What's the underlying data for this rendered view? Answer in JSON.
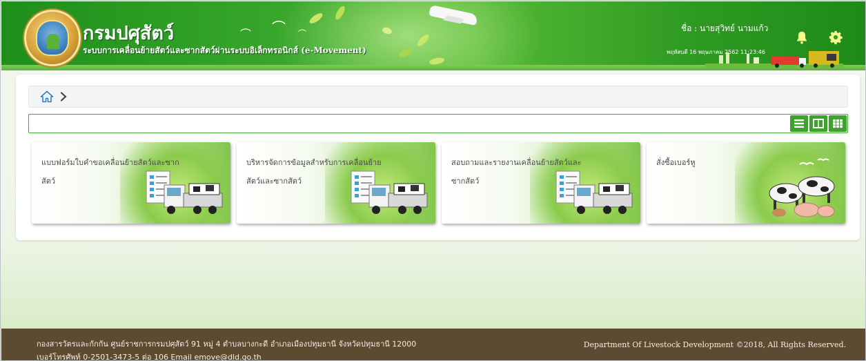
{
  "header": {
    "title": "กรมปศุสัตว์",
    "subtitle": "ระบบการเคลื่อนย้ายสัตว์และซากสัตว์ผ่านระบบอิเล็กทรอนิกส์ (e-Movement)",
    "user_label": "ชื่อ : นายสุวิทย์ นามแก้ว",
    "datetime": "พฤหัสบดี 16 พฤษภาคม 2562 11:23:46",
    "icons": [
      "logo-emblem",
      "bell-icon",
      "gear-icon"
    ],
    "colors": {
      "header_green": "#2f9a22",
      "accent": "#3ea32d"
    }
  },
  "breadcrumb": {
    "icons": [
      "home-icon",
      "chevron-right-icon"
    ]
  },
  "search": {
    "value": "",
    "view_icons": [
      "list-view-icon",
      "split-view-icon",
      "grid-view-icon"
    ]
  },
  "menu_cards": [
    {
      "label": "แบบฟอร์มใบคำขอเคลื่อนย้ายสัตว์และซากสัตว์",
      "icon": "truck-cattle-document-illustration"
    },
    {
      "label": "บริหารจัดการข้อมูลสำหรับการเคลื่อนย้ายสัตว์และซากสัตว์",
      "icon": "truck-cattle-document-illustration"
    },
    {
      "label": "สอบถามและรายงานเคลื่อนย้ายสัตว์และซากสัตว์",
      "icon": "truck-cattle-document-illustration"
    },
    {
      "label": "สั่งซื้อเบอร์หู",
      "icon": "livestock-illustration"
    }
  ],
  "footer": {
    "address_line1": "กองสารวัตรและกักกัน ศูนย์ราชการกรมปศุสัตว์ 91 หมู่ 4 ตำบลบางกะดี อำเภอเมืองปทุมธานี จังหวัดปทุมธานี 12000",
    "address_line2": "เบอร์โทรศัพท์ 0-2501-3473-5 ต่อ 106 Email emove@dld.go.th",
    "copyright": "Department Of Livestock Development ©2018, All Rights Reserved.",
    "colors": {
      "footer_bg": "#5c4a31"
    }
  }
}
